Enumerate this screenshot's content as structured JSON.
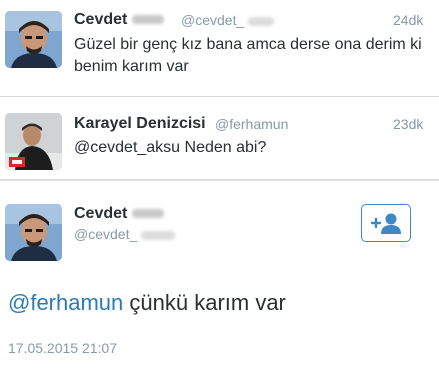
{
  "tweets": [
    {
      "name": "Cevdet",
      "handle": "@cevdet_",
      "time": "24dk",
      "text": "Güzel bir genç kız bana amca derse ona derim ki benim karım var"
    },
    {
      "name": "Karayel Denizcisi",
      "handle": "@ferhamun",
      "time": "23dk",
      "text": "@cevdet_aksu Neden abi?"
    }
  ],
  "detail": {
    "name": "Cevdet",
    "handle": "@cevdet_",
    "mention": "@ferhamun",
    "text": " çünkü karım var",
    "date": "17.05.2015 21:07",
    "follow_icon": "add-user-icon"
  },
  "colors": {
    "link": "#2b7bb9",
    "secondary": "#8899a6",
    "border": "#3e87c6"
  }
}
